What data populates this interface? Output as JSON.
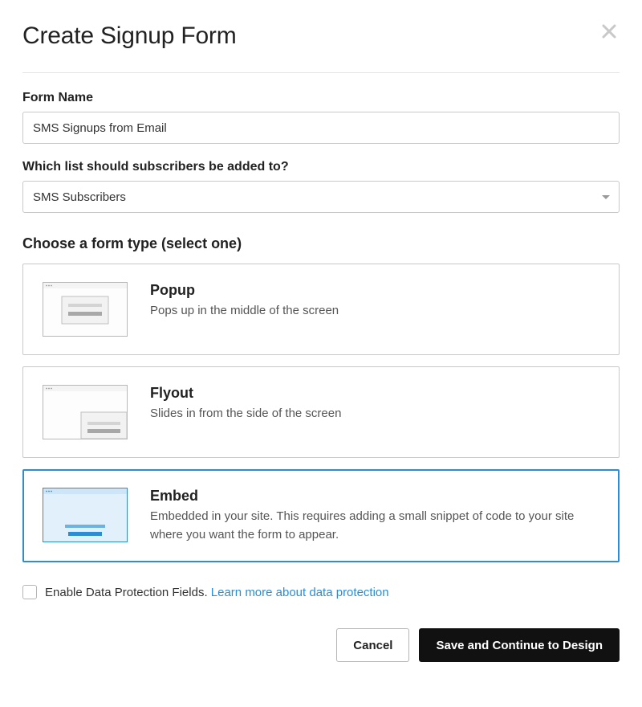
{
  "modal": {
    "title": "Create Signup Form"
  },
  "formName": {
    "label": "Form Name",
    "value": "SMS Signups from Email"
  },
  "listSelect": {
    "label": "Which list should subscribers be added to?",
    "value": "SMS Subscribers"
  },
  "formType": {
    "heading": "Choose a form type (select one)",
    "options": [
      {
        "key": "popup",
        "title": "Popup",
        "desc": "Pops up in the middle of the screen",
        "selected": false
      },
      {
        "key": "flyout",
        "title": "Flyout",
        "desc": "Slides in from the side of the screen",
        "selected": false
      },
      {
        "key": "embed",
        "title": "Embed",
        "desc": "Embedded in your site. This requires adding a small snippet of code to your site where you want the form to appear.",
        "selected": true
      }
    ]
  },
  "dataProtection": {
    "checked": false,
    "label": "Enable Data Protection Fields. ",
    "linkText": "Learn more about data protection"
  },
  "footer": {
    "cancel": "Cancel",
    "submit": "Save and Continue to Design"
  },
  "colors": {
    "accent": "#2a8dd6"
  }
}
